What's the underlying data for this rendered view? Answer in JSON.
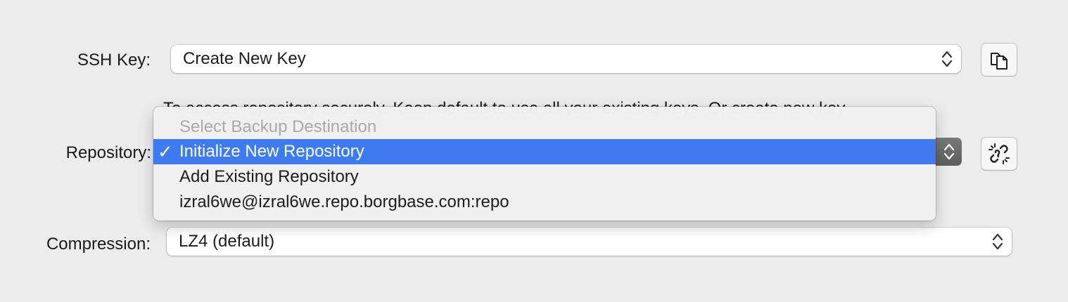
{
  "ssh_key": {
    "label": "SSH Key:",
    "selected": "Create New Key",
    "hint": "To access repository securely, Keep default to use all your existing keys. Or create new key."
  },
  "repository": {
    "label": "Repository:",
    "menu_items": [
      {
        "label": "Select Backup Destination",
        "state": "disabled"
      },
      {
        "label": "Initialize New Repository",
        "state": "selected",
        "check": "✓"
      },
      {
        "label": "Add Existing Repository",
        "state": "normal"
      },
      {
        "label": "izral6we@izral6we.repo.borgbase.com:repo",
        "state": "normal"
      }
    ]
  },
  "compression": {
    "label": "Compression:",
    "selected": "LZ4 (default)"
  },
  "icons": {
    "copy": "copy-icon",
    "unlink": "unlink-icon",
    "stepper": "chevron-updown-icon"
  },
  "colors": {
    "background": "#ececec",
    "highlight": "#3d7cf0",
    "disabled_text": "#a9a9a9"
  }
}
